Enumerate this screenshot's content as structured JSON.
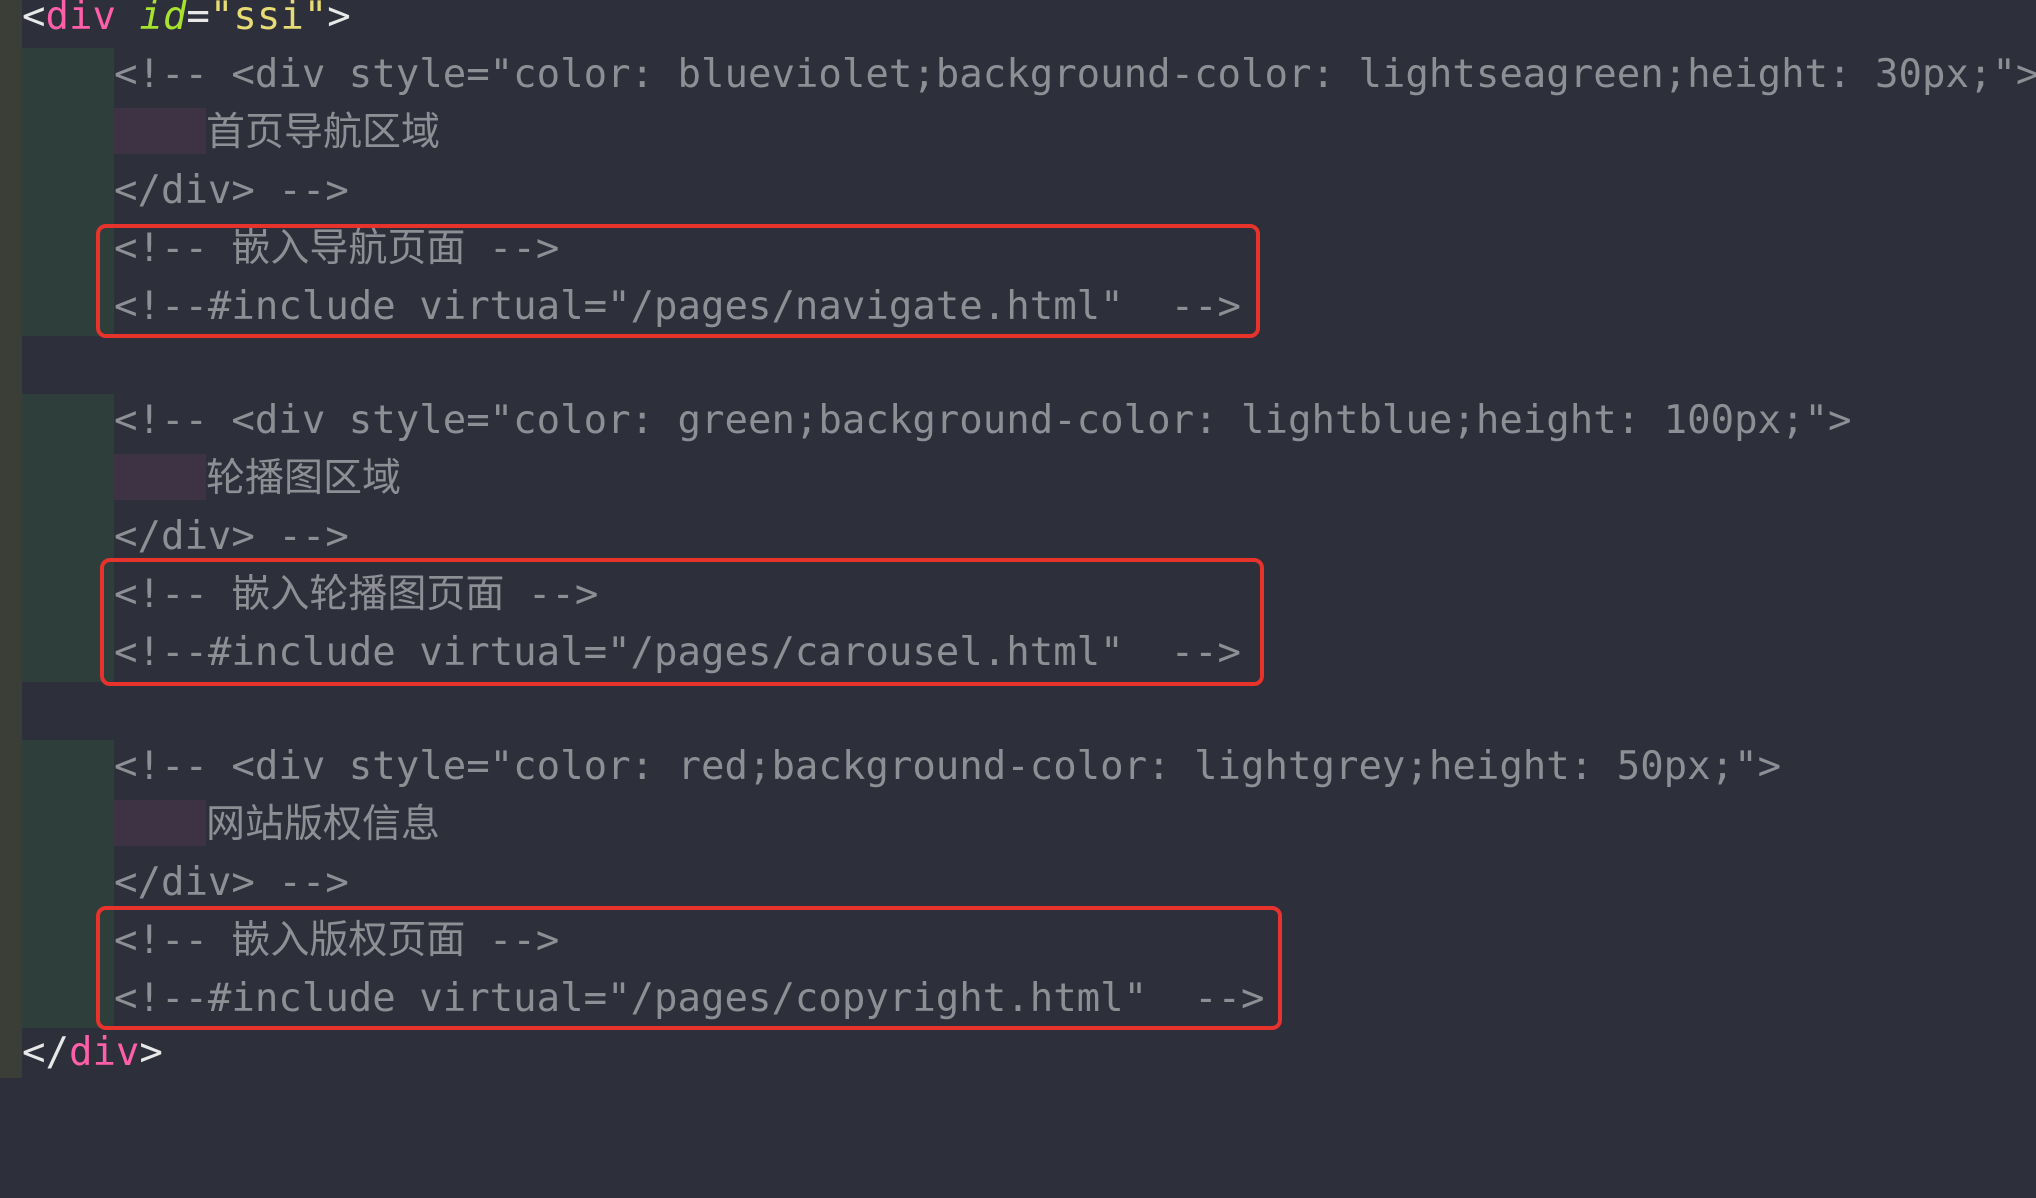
{
  "editor": {
    "colors": {
      "background": "#2d2f3b",
      "tag": "#ff5fa8",
      "attr": "#a6e22e",
      "string": "#e6db74",
      "comment": "#8e8f95",
      "highlight": "#e8322c"
    },
    "open_tag": {
      "lt": "<",
      "name": "div",
      "attr": "id",
      "eq": "=",
      "value": "\"ssi\"",
      "gt": ">"
    },
    "close_tag": {
      "lt": "</",
      "name": "div",
      "gt": ">"
    },
    "lines": [
      "<!-- <div style=\"color: blueviolet;background-color: lightseagreen;height: 30px;\">",
      "首页导航区域",
      "</div> -->",
      "<!-- 嵌入导航页面 -->",
      "<!--#include virtual=\"/pages/navigate.html\"  -->",
      "<!-- <div style=\"color: green;background-color: lightblue;height: 100px;\">",
      "轮播图区域",
      "</div> -->",
      "<!-- 嵌入轮播图页面 -->",
      "<!--#include virtual=\"/pages/carousel.html\"  -->",
      "<!-- <div style=\"color: red;background-color: lightgrey;height: 50px;\">",
      "网站版权信息",
      "</div> -->",
      "<!-- 嵌入版权页面 -->",
      "<!--#include virtual=\"/pages/copyright.html\"  -->"
    ]
  }
}
